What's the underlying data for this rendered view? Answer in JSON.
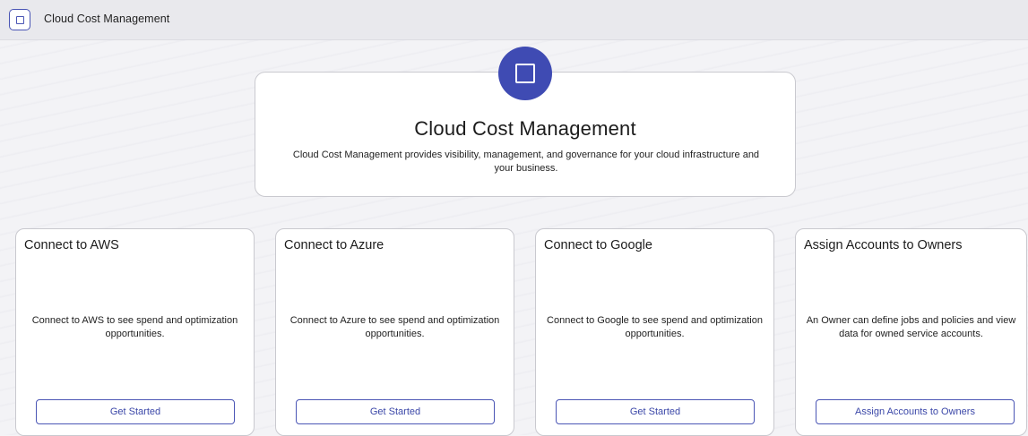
{
  "header": {
    "app_icon": "square-icon",
    "title": "Cloud Cost Management"
  },
  "hero": {
    "icon": "square-icon",
    "title": "Cloud Cost Management",
    "description": "Cloud Cost Management provides visibility, management, and governance for your cloud infrastructure and your business."
  },
  "cards": [
    {
      "title": "Connect to AWS",
      "text": "Connect to AWS to see spend and optimization opportunities.",
      "button": "Get Started"
    },
    {
      "title": "Connect to Azure",
      "text": "Connect to Azure to see spend and optimization opportunities.",
      "button": "Get Started"
    },
    {
      "title": "Connect to Google",
      "text": "Connect to Google to see spend and optimization opportunities.",
      "button": "Get Started"
    },
    {
      "title": "Assign Accounts to Owners",
      "text": "An Owner can define jobs and policies and view data for owned service accounts.",
      "button": "Assign Accounts to Owners"
    }
  ],
  "colors": {
    "accent": "#3f4bb3",
    "button_text": "#3b47a8",
    "topbar_bg": "#e9e9ed"
  }
}
